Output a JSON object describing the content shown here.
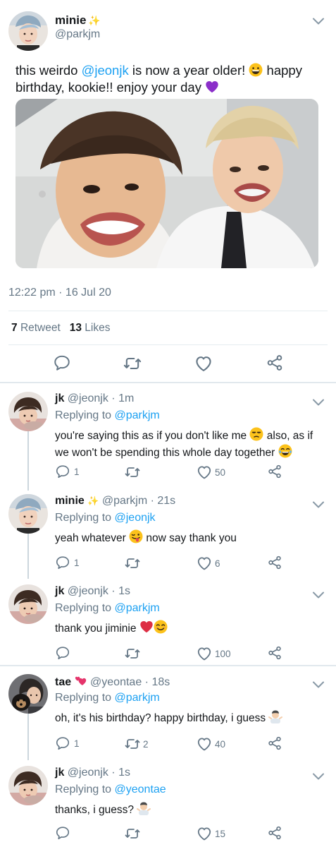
{
  "main_tweet": {
    "name": "minie",
    "name_decoration": "✨",
    "handle": "@parkjm",
    "text_parts": {
      "pre": "this weirdo ",
      "mention": "@jeonjk",
      "mid": " is now a year older! ",
      "post": " happy birthday, kookie!! enjoy your day "
    },
    "timestamp": "12:22 pm · 16 Jul 20",
    "retweet_count": "7",
    "retweet_label": "Retweet",
    "like_count": "13",
    "like_label": "Likes"
  },
  "replies": [
    {
      "name": "jk",
      "handle": "@jeonjk",
      "time": "· 1m",
      "replying_label": "Replying to",
      "replying_to": "@parkjm",
      "text_a": "you're saying this as if you don't like me ",
      "text_b": " also, as if we won't be spending this whole day together ",
      "reply_count": "1",
      "retweet_count": "",
      "like_count": "50"
    },
    {
      "name": "minie",
      "name_decoration": "✨",
      "handle": "@parkjm",
      "time": "· 21s",
      "replying_label": "Replying to",
      "replying_to": "@jeonjk",
      "text_a": "yeah whatever ",
      "text_b": " now say thank you",
      "reply_count": "1",
      "retweet_count": "",
      "like_count": "6"
    },
    {
      "name": "jk",
      "handle": "@jeonjk",
      "time": "· 1s",
      "replying_label": "Replying to",
      "replying_to": "@parkjm",
      "text_a": "thank you jiminie ",
      "reply_count": "",
      "retweet_count": "",
      "like_count": "100"
    },
    {
      "name": "tae",
      "handle": "@yeontae",
      "time": "· 18s",
      "replying_label": "Replying to",
      "replying_to": "@parkjm",
      "text_a": "oh, it's his birthday? happy birthday, i guess ",
      "reply_count": "1",
      "retweet_count": "2",
      "like_count": "40"
    },
    {
      "name": "jk",
      "handle": "@jeonjk",
      "time": "· 1s",
      "replying_label": "Replying to",
      "replying_to": "@yeontae",
      "text_a": "thanks, i guess? ",
      "reply_count": "",
      "retweet_count": "",
      "like_count": "15"
    }
  ],
  "icons": {
    "reply": "speech-bubble-icon",
    "retweet": "retweet-icon",
    "like": "heart-icon",
    "share": "share-icon",
    "more": "chevron-down-icon"
  },
  "colors": {
    "accent": "#1da1f2",
    "secondary_text": "#657786",
    "divider": "#e6ecf0",
    "heart_red": "#e0245e",
    "purple_heart": "#8b2fc9"
  }
}
